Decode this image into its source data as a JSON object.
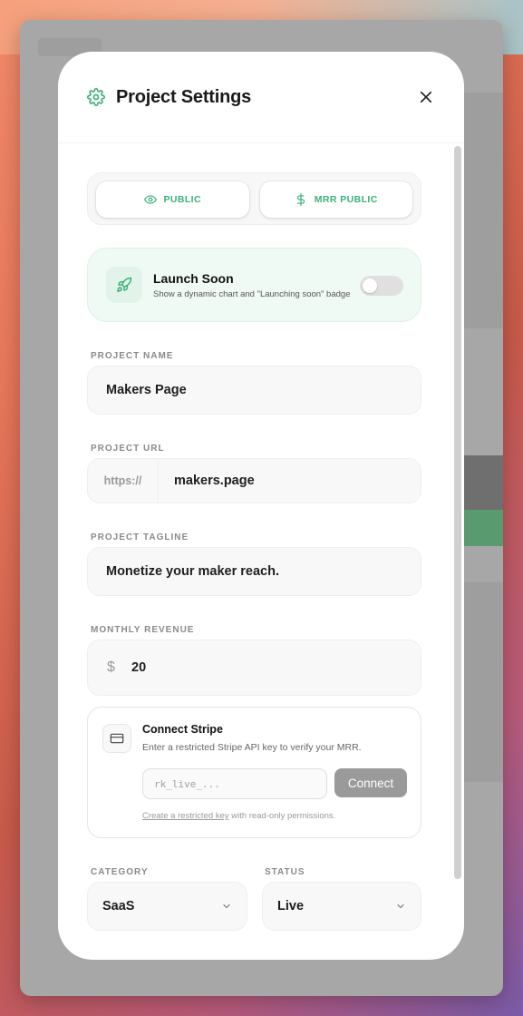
{
  "header": {
    "title": "Project Settings"
  },
  "visibility": {
    "public_label": "PUBLIC",
    "mrr_public_label": "MRR PUBLIC"
  },
  "launch": {
    "title": "Launch Soon",
    "subtitle": "Show a dynamic chart and \"Launching soon\" badge",
    "enabled": false
  },
  "fields": {
    "name": {
      "label": "PROJECT NAME",
      "value": "Makers Page"
    },
    "url": {
      "label": "PROJECT URL",
      "prefix": "https://",
      "value": "makers.page"
    },
    "tagline": {
      "label": "PROJECT TAGLINE",
      "value": "Monetize your maker reach."
    },
    "revenue": {
      "label": "MONTHLY REVENUE",
      "currency": "$",
      "value": "20"
    }
  },
  "stripe": {
    "title": "Connect Stripe",
    "subtitle": "Enter a restricted Stripe API key to verify your MRR.",
    "placeholder": "rk_live_...",
    "button": "Connect",
    "link_text": "Create a restricted key",
    "footer_rest": " with read-only permissions."
  },
  "category": {
    "label": "CATEGORY",
    "value": "SaaS"
  },
  "status": {
    "label": "STATUS",
    "value": "Live"
  },
  "colors": {
    "accent": "#3bb07a",
    "launch_bg": "#f0faf4",
    "connect_btn": "#9a9a9a"
  },
  "icons": {
    "header": "gear-icon",
    "close": "close-icon",
    "public": "eye-icon",
    "mrr": "dollar-icon",
    "launch": "rocket-icon",
    "stripe": "credit-card-icon",
    "select": "chevron-down-icon"
  }
}
